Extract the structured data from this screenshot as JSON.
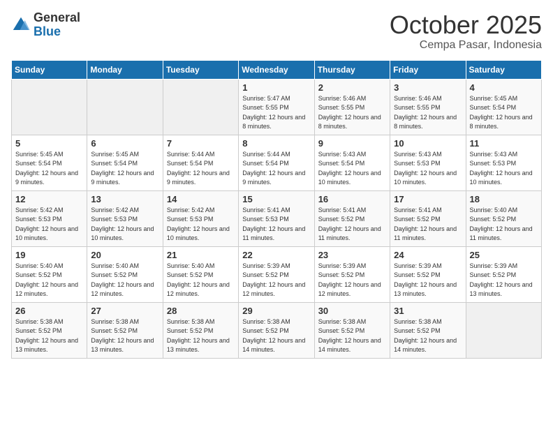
{
  "header": {
    "logo_general": "General",
    "logo_blue": "Blue",
    "title": "October 2025",
    "subtitle": "Cempa Pasar, Indonesia"
  },
  "weekdays": [
    "Sunday",
    "Monday",
    "Tuesday",
    "Wednesday",
    "Thursday",
    "Friday",
    "Saturday"
  ],
  "weeks": [
    [
      {
        "day": "",
        "sunrise": "",
        "sunset": "",
        "daylight": ""
      },
      {
        "day": "",
        "sunrise": "",
        "sunset": "",
        "daylight": ""
      },
      {
        "day": "",
        "sunrise": "",
        "sunset": "",
        "daylight": ""
      },
      {
        "day": "1",
        "sunrise": "Sunrise: 5:47 AM",
        "sunset": "Sunset: 5:55 PM",
        "daylight": "Daylight: 12 hours and 8 minutes."
      },
      {
        "day": "2",
        "sunrise": "Sunrise: 5:46 AM",
        "sunset": "Sunset: 5:55 PM",
        "daylight": "Daylight: 12 hours and 8 minutes."
      },
      {
        "day": "3",
        "sunrise": "Sunrise: 5:46 AM",
        "sunset": "Sunset: 5:55 PM",
        "daylight": "Daylight: 12 hours and 8 minutes."
      },
      {
        "day": "4",
        "sunrise": "Sunrise: 5:45 AM",
        "sunset": "Sunset: 5:54 PM",
        "daylight": "Daylight: 12 hours and 8 minutes."
      }
    ],
    [
      {
        "day": "5",
        "sunrise": "Sunrise: 5:45 AM",
        "sunset": "Sunset: 5:54 PM",
        "daylight": "Daylight: 12 hours and 9 minutes."
      },
      {
        "day": "6",
        "sunrise": "Sunrise: 5:45 AM",
        "sunset": "Sunset: 5:54 PM",
        "daylight": "Daylight: 12 hours and 9 minutes."
      },
      {
        "day": "7",
        "sunrise": "Sunrise: 5:44 AM",
        "sunset": "Sunset: 5:54 PM",
        "daylight": "Daylight: 12 hours and 9 minutes."
      },
      {
        "day": "8",
        "sunrise": "Sunrise: 5:44 AM",
        "sunset": "Sunset: 5:54 PM",
        "daylight": "Daylight: 12 hours and 9 minutes."
      },
      {
        "day": "9",
        "sunrise": "Sunrise: 5:43 AM",
        "sunset": "Sunset: 5:54 PM",
        "daylight": "Daylight: 12 hours and 10 minutes."
      },
      {
        "day": "10",
        "sunrise": "Sunrise: 5:43 AM",
        "sunset": "Sunset: 5:53 PM",
        "daylight": "Daylight: 12 hours and 10 minutes."
      },
      {
        "day": "11",
        "sunrise": "Sunrise: 5:43 AM",
        "sunset": "Sunset: 5:53 PM",
        "daylight": "Daylight: 12 hours and 10 minutes."
      }
    ],
    [
      {
        "day": "12",
        "sunrise": "Sunrise: 5:42 AM",
        "sunset": "Sunset: 5:53 PM",
        "daylight": "Daylight: 12 hours and 10 minutes."
      },
      {
        "day": "13",
        "sunrise": "Sunrise: 5:42 AM",
        "sunset": "Sunset: 5:53 PM",
        "daylight": "Daylight: 12 hours and 10 minutes."
      },
      {
        "day": "14",
        "sunrise": "Sunrise: 5:42 AM",
        "sunset": "Sunset: 5:53 PM",
        "daylight": "Daylight: 12 hours and 10 minutes."
      },
      {
        "day": "15",
        "sunrise": "Sunrise: 5:41 AM",
        "sunset": "Sunset: 5:53 PM",
        "daylight": "Daylight: 12 hours and 11 minutes."
      },
      {
        "day": "16",
        "sunrise": "Sunrise: 5:41 AM",
        "sunset": "Sunset: 5:52 PM",
        "daylight": "Daylight: 12 hours and 11 minutes."
      },
      {
        "day": "17",
        "sunrise": "Sunrise: 5:41 AM",
        "sunset": "Sunset: 5:52 PM",
        "daylight": "Daylight: 12 hours and 11 minutes."
      },
      {
        "day": "18",
        "sunrise": "Sunrise: 5:40 AM",
        "sunset": "Sunset: 5:52 PM",
        "daylight": "Daylight: 12 hours and 11 minutes."
      }
    ],
    [
      {
        "day": "19",
        "sunrise": "Sunrise: 5:40 AM",
        "sunset": "Sunset: 5:52 PM",
        "daylight": "Daylight: 12 hours and 12 minutes."
      },
      {
        "day": "20",
        "sunrise": "Sunrise: 5:40 AM",
        "sunset": "Sunset: 5:52 PM",
        "daylight": "Daylight: 12 hours and 12 minutes."
      },
      {
        "day": "21",
        "sunrise": "Sunrise: 5:40 AM",
        "sunset": "Sunset: 5:52 PM",
        "daylight": "Daylight: 12 hours and 12 minutes."
      },
      {
        "day": "22",
        "sunrise": "Sunrise: 5:39 AM",
        "sunset": "Sunset: 5:52 PM",
        "daylight": "Daylight: 12 hours and 12 minutes."
      },
      {
        "day": "23",
        "sunrise": "Sunrise: 5:39 AM",
        "sunset": "Sunset: 5:52 PM",
        "daylight": "Daylight: 12 hours and 12 minutes."
      },
      {
        "day": "24",
        "sunrise": "Sunrise: 5:39 AM",
        "sunset": "Sunset: 5:52 PM",
        "daylight": "Daylight: 12 hours and 13 minutes."
      },
      {
        "day": "25",
        "sunrise": "Sunrise: 5:39 AM",
        "sunset": "Sunset: 5:52 PM",
        "daylight": "Daylight: 12 hours and 13 minutes."
      }
    ],
    [
      {
        "day": "26",
        "sunrise": "Sunrise: 5:38 AM",
        "sunset": "Sunset: 5:52 PM",
        "daylight": "Daylight: 12 hours and 13 minutes."
      },
      {
        "day": "27",
        "sunrise": "Sunrise: 5:38 AM",
        "sunset": "Sunset: 5:52 PM",
        "daylight": "Daylight: 12 hours and 13 minutes."
      },
      {
        "day": "28",
        "sunrise": "Sunrise: 5:38 AM",
        "sunset": "Sunset: 5:52 PM",
        "daylight": "Daylight: 12 hours and 13 minutes."
      },
      {
        "day": "29",
        "sunrise": "Sunrise: 5:38 AM",
        "sunset": "Sunset: 5:52 PM",
        "daylight": "Daylight: 12 hours and 14 minutes."
      },
      {
        "day": "30",
        "sunrise": "Sunrise: 5:38 AM",
        "sunset": "Sunset: 5:52 PM",
        "daylight": "Daylight: 12 hours and 14 minutes."
      },
      {
        "day": "31",
        "sunrise": "Sunrise: 5:38 AM",
        "sunset": "Sunset: 5:52 PM",
        "daylight": "Daylight: 12 hours and 14 minutes."
      },
      {
        "day": "",
        "sunrise": "",
        "sunset": "",
        "daylight": ""
      }
    ]
  ]
}
